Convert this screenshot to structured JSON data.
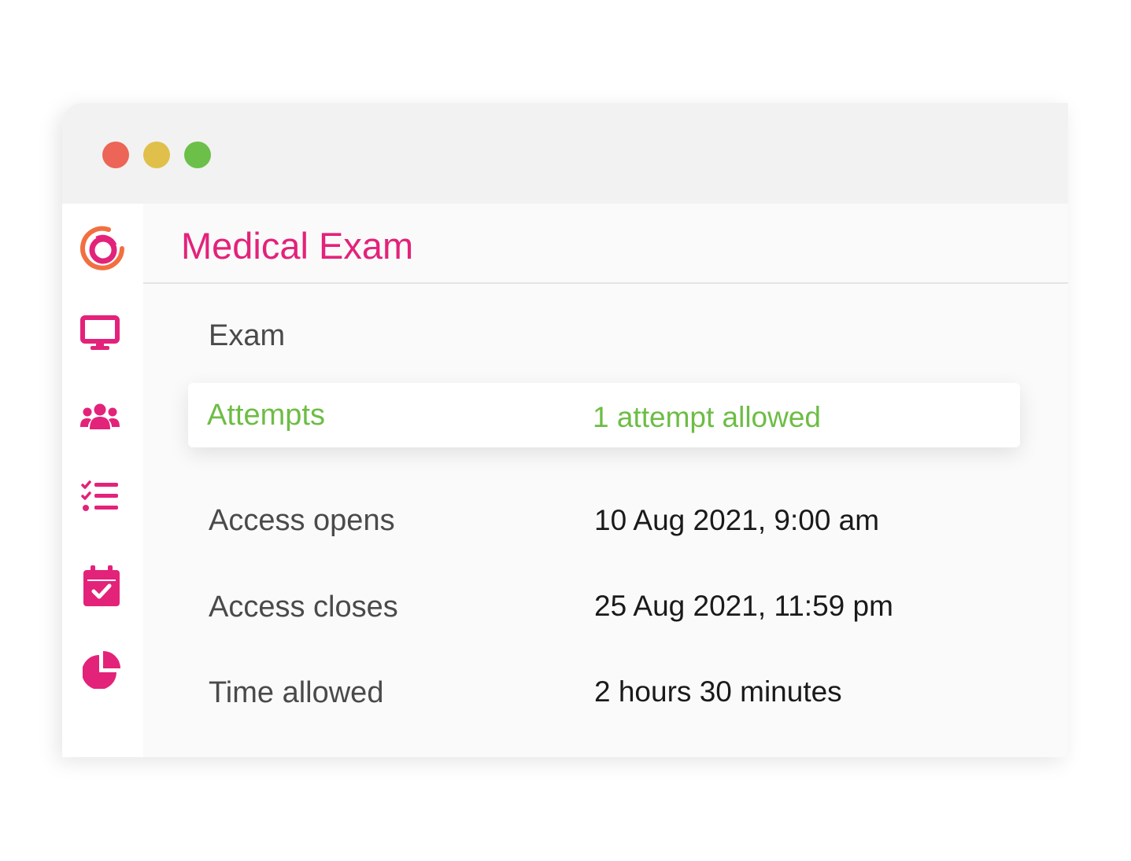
{
  "colors": {
    "brand": "#e3227a",
    "accent_green": "#6dbd45",
    "label_gray": "#4a4a4a",
    "value_dark": "#1a1a1a",
    "logo_orange": "#f26f41",
    "dot_red": "#ec6557",
    "dot_yellow": "#e0c04a",
    "dot_green": "#6cc04a"
  },
  "window": {
    "controls": [
      "close",
      "minimize",
      "maximize"
    ]
  },
  "sidebar": {
    "items": [
      {
        "icon": "app-logo-icon"
      },
      {
        "icon": "monitor-icon"
      },
      {
        "icon": "users-icon"
      },
      {
        "icon": "checklist-icon"
      },
      {
        "icon": "calendar-check-icon"
      },
      {
        "icon": "pie-chart-icon"
      }
    ]
  },
  "page": {
    "title": "Medical Exam",
    "section": "Exam"
  },
  "settings": [
    {
      "label": "Attempts",
      "value": "1 attempt allowed",
      "highlighted": true
    },
    {
      "label": "Access opens",
      "value": "10 Aug 2021, 9:00 am"
    },
    {
      "label": "Access closes",
      "value": "25 Aug 2021, 11:59 pm"
    },
    {
      "label": "Time allowed",
      "value": "2 hours 30 minutes"
    }
  ]
}
